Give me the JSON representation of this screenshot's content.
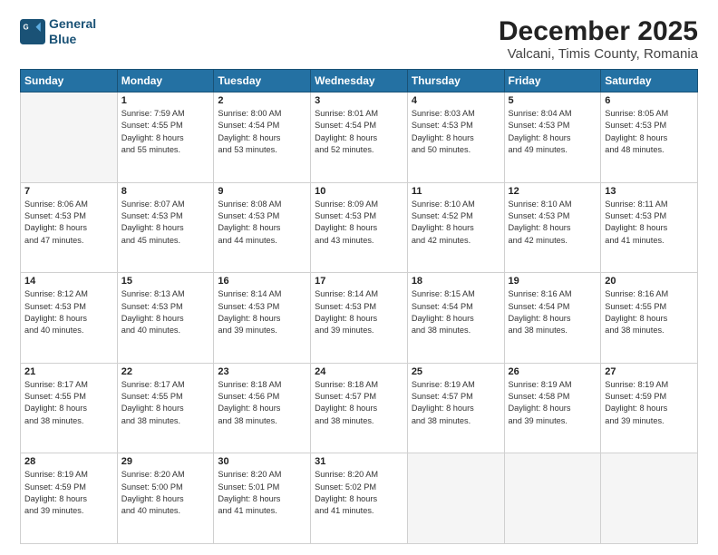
{
  "header": {
    "logo_line1": "General",
    "logo_line2": "Blue",
    "title": "December 2025",
    "subtitle": "Valcani, Timis County, Romania"
  },
  "columns": [
    "Sunday",
    "Monday",
    "Tuesday",
    "Wednesday",
    "Thursday",
    "Friday",
    "Saturday"
  ],
  "weeks": [
    [
      {
        "num": "",
        "info": ""
      },
      {
        "num": "1",
        "info": "Sunrise: 7:59 AM\nSunset: 4:55 PM\nDaylight: 8 hours\nand 55 minutes."
      },
      {
        "num": "2",
        "info": "Sunrise: 8:00 AM\nSunset: 4:54 PM\nDaylight: 8 hours\nand 53 minutes."
      },
      {
        "num": "3",
        "info": "Sunrise: 8:01 AM\nSunset: 4:54 PM\nDaylight: 8 hours\nand 52 minutes."
      },
      {
        "num": "4",
        "info": "Sunrise: 8:03 AM\nSunset: 4:53 PM\nDaylight: 8 hours\nand 50 minutes."
      },
      {
        "num": "5",
        "info": "Sunrise: 8:04 AM\nSunset: 4:53 PM\nDaylight: 8 hours\nand 49 minutes."
      },
      {
        "num": "6",
        "info": "Sunrise: 8:05 AM\nSunset: 4:53 PM\nDaylight: 8 hours\nand 48 minutes."
      }
    ],
    [
      {
        "num": "7",
        "info": "Sunrise: 8:06 AM\nSunset: 4:53 PM\nDaylight: 8 hours\nand 47 minutes."
      },
      {
        "num": "8",
        "info": "Sunrise: 8:07 AM\nSunset: 4:53 PM\nDaylight: 8 hours\nand 45 minutes."
      },
      {
        "num": "9",
        "info": "Sunrise: 8:08 AM\nSunset: 4:53 PM\nDaylight: 8 hours\nand 44 minutes."
      },
      {
        "num": "10",
        "info": "Sunrise: 8:09 AM\nSunset: 4:53 PM\nDaylight: 8 hours\nand 43 minutes."
      },
      {
        "num": "11",
        "info": "Sunrise: 8:10 AM\nSunset: 4:52 PM\nDaylight: 8 hours\nand 42 minutes."
      },
      {
        "num": "12",
        "info": "Sunrise: 8:10 AM\nSunset: 4:53 PM\nDaylight: 8 hours\nand 42 minutes."
      },
      {
        "num": "13",
        "info": "Sunrise: 8:11 AM\nSunset: 4:53 PM\nDaylight: 8 hours\nand 41 minutes."
      }
    ],
    [
      {
        "num": "14",
        "info": "Sunrise: 8:12 AM\nSunset: 4:53 PM\nDaylight: 8 hours\nand 40 minutes."
      },
      {
        "num": "15",
        "info": "Sunrise: 8:13 AM\nSunset: 4:53 PM\nDaylight: 8 hours\nand 40 minutes."
      },
      {
        "num": "16",
        "info": "Sunrise: 8:14 AM\nSunset: 4:53 PM\nDaylight: 8 hours\nand 39 minutes."
      },
      {
        "num": "17",
        "info": "Sunrise: 8:14 AM\nSunset: 4:53 PM\nDaylight: 8 hours\nand 39 minutes."
      },
      {
        "num": "18",
        "info": "Sunrise: 8:15 AM\nSunset: 4:54 PM\nDaylight: 8 hours\nand 38 minutes."
      },
      {
        "num": "19",
        "info": "Sunrise: 8:16 AM\nSunset: 4:54 PM\nDaylight: 8 hours\nand 38 minutes."
      },
      {
        "num": "20",
        "info": "Sunrise: 8:16 AM\nSunset: 4:55 PM\nDaylight: 8 hours\nand 38 minutes."
      }
    ],
    [
      {
        "num": "21",
        "info": "Sunrise: 8:17 AM\nSunset: 4:55 PM\nDaylight: 8 hours\nand 38 minutes."
      },
      {
        "num": "22",
        "info": "Sunrise: 8:17 AM\nSunset: 4:55 PM\nDaylight: 8 hours\nand 38 minutes."
      },
      {
        "num": "23",
        "info": "Sunrise: 8:18 AM\nSunset: 4:56 PM\nDaylight: 8 hours\nand 38 minutes."
      },
      {
        "num": "24",
        "info": "Sunrise: 8:18 AM\nSunset: 4:57 PM\nDaylight: 8 hours\nand 38 minutes."
      },
      {
        "num": "25",
        "info": "Sunrise: 8:19 AM\nSunset: 4:57 PM\nDaylight: 8 hours\nand 38 minutes."
      },
      {
        "num": "26",
        "info": "Sunrise: 8:19 AM\nSunset: 4:58 PM\nDaylight: 8 hours\nand 39 minutes."
      },
      {
        "num": "27",
        "info": "Sunrise: 8:19 AM\nSunset: 4:59 PM\nDaylight: 8 hours\nand 39 minutes."
      }
    ],
    [
      {
        "num": "28",
        "info": "Sunrise: 8:19 AM\nSunset: 4:59 PM\nDaylight: 8 hours\nand 39 minutes."
      },
      {
        "num": "29",
        "info": "Sunrise: 8:20 AM\nSunset: 5:00 PM\nDaylight: 8 hours\nand 40 minutes."
      },
      {
        "num": "30",
        "info": "Sunrise: 8:20 AM\nSunset: 5:01 PM\nDaylight: 8 hours\nand 41 minutes."
      },
      {
        "num": "31",
        "info": "Sunrise: 8:20 AM\nSunset: 5:02 PM\nDaylight: 8 hours\nand 41 minutes."
      },
      {
        "num": "",
        "info": ""
      },
      {
        "num": "",
        "info": ""
      },
      {
        "num": "",
        "info": ""
      }
    ]
  ]
}
